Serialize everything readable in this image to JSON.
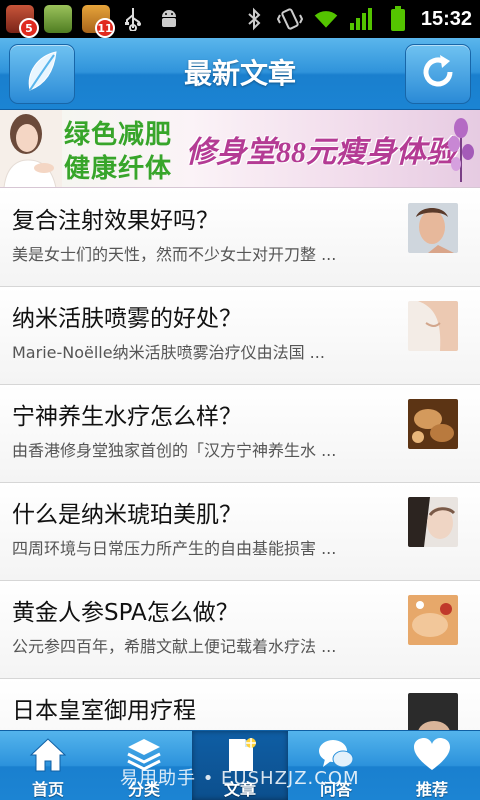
{
  "status_bar": {
    "notifications": [
      {
        "icon": "app-notification-icon",
        "badge": "5"
      },
      {
        "icon": "android-app-icon",
        "badge": ""
      },
      {
        "icon": "app-notification-icon",
        "badge": "11"
      }
    ],
    "time": "15:32"
  },
  "header": {
    "title": "最新文章",
    "left_icon": "leaf-icon",
    "right_icon": "refresh-icon"
  },
  "banner": {
    "line1": "绿色减肥",
    "line2": "健康纤体",
    "promo": "修身堂88元瘦身体验"
  },
  "articles": [
    {
      "title": "复合注射效果好吗？",
      "summary": "美是女士们的天性，然而不少女士对开刀整 ...",
      "thumb_color": "#d9a58a"
    },
    {
      "title": "纳米活肤喷雾的好处？",
      "summary": "Marie-Noëlle纳米活肤喷雾治疗仪由法国 ...",
      "thumb_color": "#e9c9b3"
    },
    {
      "title": "宁神养生水疗怎么样？",
      "summary": "由香港修身堂独家首创的「汉方宁神养生水 ...",
      "thumb_color": "#8a5a2c"
    },
    {
      "title": "什么是纳米琥珀美肌？",
      "summary": "四周环境与日常压力所产生的自由基能损害 ...",
      "thumb_color": "#c9b4a6"
    },
    {
      "title": "黄金人参SPA怎么做？",
      "summary": "公元参四百年，希腊文献上便记载着水疗法 ...",
      "thumb_color": "#c27a3a"
    },
    {
      "title": "日本皇室御用疗程",
      "summary": "",
      "thumb_color": "#3a3a3a"
    }
  ],
  "tabs": [
    {
      "label": "首页",
      "icon": "home-icon",
      "active": false
    },
    {
      "label": "分类",
      "icon": "layers-icon",
      "active": false
    },
    {
      "label": "文章",
      "icon": "document-icon",
      "active": true
    },
    {
      "label": "问答",
      "icon": "chat-bubbles-icon",
      "active": false
    },
    {
      "label": "推荐",
      "icon": "heart-icon",
      "active": false
    }
  ],
  "watermark": "易用助手 • EUSHZJZ.COM"
}
